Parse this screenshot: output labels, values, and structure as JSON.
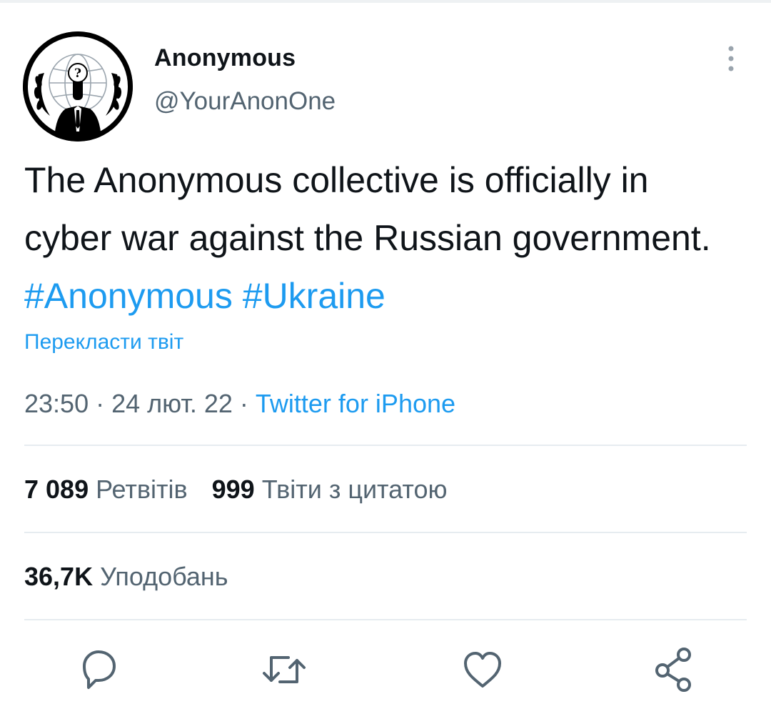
{
  "author": {
    "display_name": "Anonymous",
    "handle": "@YourAnonOne",
    "avatar_icon": "anonymous-mask-icon"
  },
  "tweet": {
    "text_parts": [
      {
        "text": "The Anonymous collective is officially in cyber war against the Russian government. ",
        "type": "text"
      },
      {
        "text": "#Anonymous",
        "type": "hashtag"
      },
      {
        "text": " ",
        "type": "text"
      },
      {
        "text": "#Ukraine",
        "type": "hashtag"
      }
    ],
    "translate_label": "Перекласти твіт",
    "time": "23:50",
    "separator": " · ",
    "date": "24 лют. 22",
    "source": "Twitter for iPhone"
  },
  "stats": {
    "retweets": {
      "count": "7 089",
      "label": "Ретвітів"
    },
    "quotes": {
      "count": "999",
      "label": "Твіти з цитатою"
    },
    "likes": {
      "count": "36,7K",
      "label": "Уподобань"
    }
  },
  "actions": {
    "icons": [
      "reply-icon",
      "retweet-icon",
      "like-icon",
      "share-icon"
    ]
  },
  "colors": {
    "link": "#1d9bf0",
    "text": "#0f1419",
    "secondary": "#536471",
    "divider": "#e6ecf0"
  }
}
